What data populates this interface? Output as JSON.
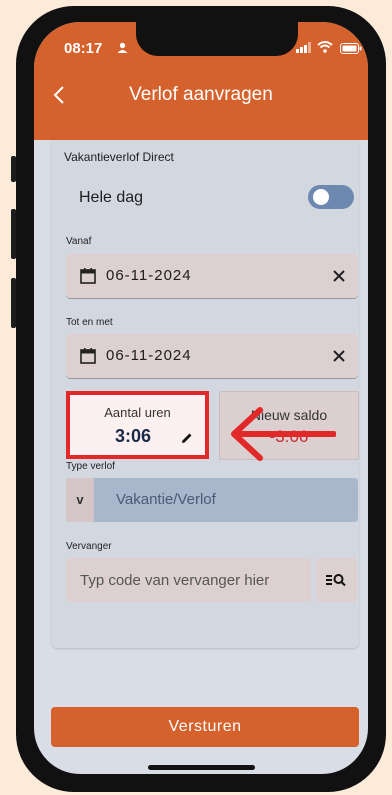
{
  "status": {
    "time": "08:17"
  },
  "header": {
    "title": "Verlof aanvragen"
  },
  "form": {
    "section_title": "Vakantieverlof Direct",
    "whole_day": {
      "label": "Hele dag",
      "on": true
    },
    "from": {
      "label": "Vanaf",
      "value": "06-11-2024"
    },
    "until": {
      "label": "Tot en met",
      "value": "06-11-2024"
    },
    "hours": {
      "label": "Aantal uren",
      "value": "3:06"
    },
    "new_balance": {
      "label": "Nieuw saldo",
      "value": "-3:06"
    },
    "leave_type": {
      "label": "Type verlof",
      "prefix": "v",
      "value": "Vakantie/Verlof"
    },
    "substitute": {
      "label": "Vervanger",
      "placeholder": "Typ code van vervanger hier"
    }
  },
  "submit_label": "Versturen",
  "colors": {
    "brand": "#d5612c",
    "highlight": "#e22929",
    "negative": "#c0302e"
  }
}
